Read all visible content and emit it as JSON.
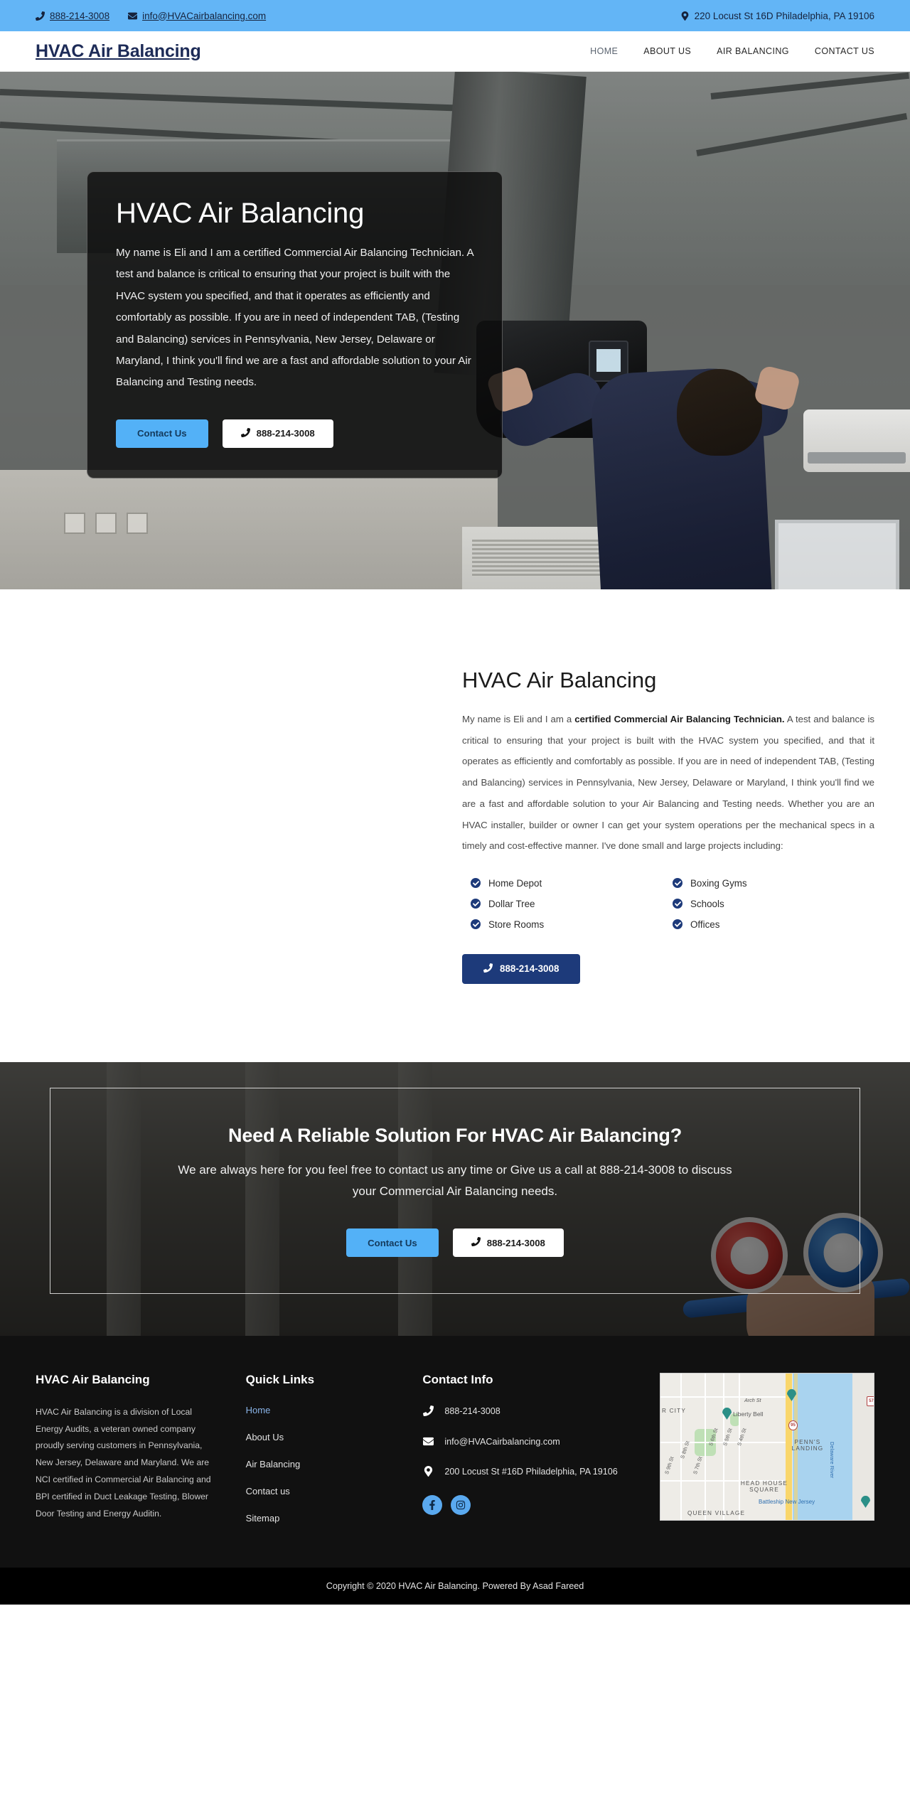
{
  "topbar": {
    "phone": "888-214-3008",
    "email": "info@HVACairbalancing.com",
    "address": "220 Locust St 16D Philadelphia, PA 19106",
    "bg_color": "#63b5f6"
  },
  "nav": {
    "brand": "HVAC Air Balancing",
    "links": [
      {
        "label": "HOME",
        "active": true
      },
      {
        "label": "ABOUT US",
        "active": false
      },
      {
        "label": "AIR BALANCING",
        "active": false
      },
      {
        "label": "CONTACT US",
        "active": false
      }
    ]
  },
  "hero": {
    "title": "HVAC Air Balancing",
    "paragraph": "My name is Eli and I am a certified Commercial Air Balancing Technician. A test and balance is critical to ensuring that your project is built with the HVAC system you specified, and that it operates as efficiently and comfortably as possible. If you are in need of independent TAB, (Testing and Balancing) services in Pennsylvania, New Jersey, Delaware or Maryland, I think you'll find we are a fast and affordable solution to your Air Balancing and Testing needs.",
    "contact_button": "Contact Us",
    "phone_button": "888-214-3008"
  },
  "about": {
    "heading": "HVAC Air Balancing",
    "intro_lead": "My name is Eli and I am a ",
    "intro_bold": "certified Commercial Air Balancing Technician.",
    "intro_rest": " A test and balance is critical to ensuring that your project is built with the HVAC system you specified, and that it operates as efficiently and comfortably as possible. If you are in need of independent TAB, (Testing and Balancing) services in Pennsylvania, New Jersey, Delaware or Maryland, I think you'll find we are a fast and affordable solution to your Air Balancing and Testing needs. Whether you are an HVAC installer, builder or owner I can get your system operations per the mechanical specs in a timely and cost-effective manner. I've done small and large projects including:",
    "features": [
      "Home Depot",
      "Boxing Gyms",
      "Dollar Tree",
      "Schools",
      "Store Rooms",
      "Offices"
    ],
    "phone_button": "888-214-3008",
    "accent_color": "#1d3a7a"
  },
  "cta": {
    "heading": "Need A Reliable Solution For HVAC Air Balancing?",
    "text": "We are always here for you feel free to contact us any time or Give us a call at 888-214-3008 to discuss your Commercial Air Balancing needs.",
    "contact_button": "Contact Us",
    "phone_button": "888-214-3008"
  },
  "footer": {
    "col1": {
      "heading": "HVAC Air Balancing",
      "text": "HVAC Air Balancing is a division of Local Energy Audits, a veteran owned company proudly serving customers in Pennsylvania, New Jersey, Delaware and Maryland. We are NCI certified in Commercial Air Balancing and BPI certified in Duct Leakage Testing, Blower Door Testing and Energy Auditin."
    },
    "col2": {
      "heading": "Quick Links",
      "links": [
        {
          "label": "Home",
          "active": true
        },
        {
          "label": "About Us",
          "active": false
        },
        {
          "label": "Air Balancing",
          "active": false
        },
        {
          "label": "Contact us",
          "active": false
        },
        {
          "label": "Sitemap",
          "active": false
        }
      ]
    },
    "col3": {
      "heading": "Contact Info",
      "phone": "888-214-3008",
      "email": "info@HVACairbalancing.com",
      "address": "200 Locust St #16D Philadelphia, PA 19106",
      "socials": [
        "facebook-icon",
        "instagram-icon"
      ]
    },
    "map": {
      "labels": [
        "R CITY",
        "Liberty Bell",
        "Arch St",
        "PENN'S LANDING",
        "HEAD HOUSE SQUARE",
        "Battleship New Jersey",
        "QUEEN VILLAGE",
        "Delaware River",
        "S 9th St",
        "S 8th St",
        "S 7th St",
        "S 6th St",
        "S 5th St",
        "S 4th St",
        "95",
        "57"
      ]
    }
  },
  "copyright": "Copyright © 2020 HVAC Air Balancing. Powered By Asad Fareed"
}
